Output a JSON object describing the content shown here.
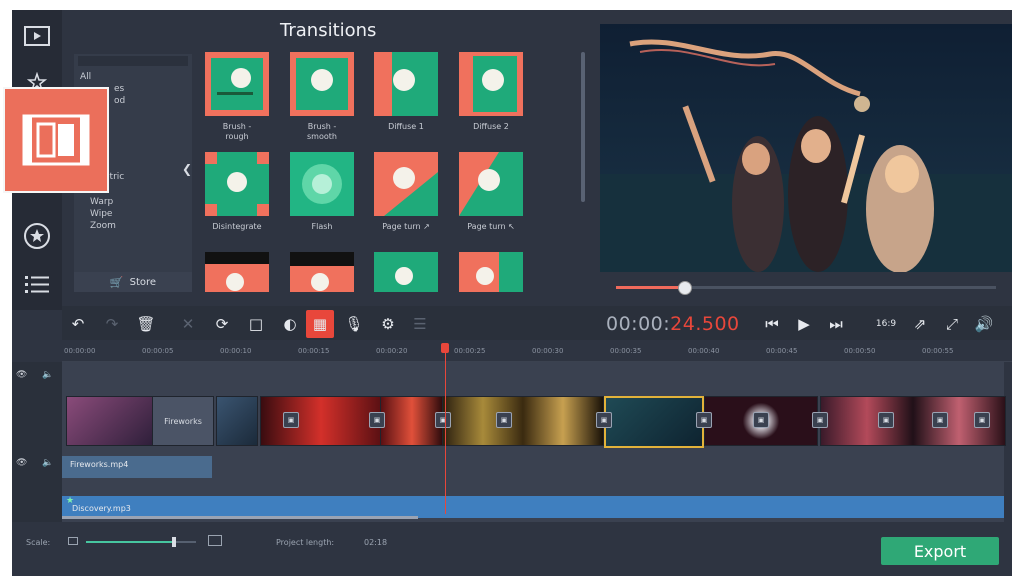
{
  "panel": {
    "title": "Transitions",
    "categories": [
      "All",
      "es",
      "od",
      "etric",
      "Warp",
      "Wipe",
      "Zoom"
    ],
    "store_label": "Store",
    "transitions": [
      {
        "label": "Brush -\nrough"
      },
      {
        "label": "Brush -\nsmooth"
      },
      {
        "label": "Diffuse 1"
      },
      {
        "label": "Diffuse 2"
      },
      {
        "label": "Disintegrate"
      },
      {
        "label": "Flash"
      },
      {
        "label": "Page turn ↗"
      },
      {
        "label": "Page turn ↖"
      }
    ]
  },
  "player": {
    "timecode_main": "00:00:",
    "timecode_accent": "24.500",
    "aspect_label": "16:9",
    "progress": 0.18
  },
  "timeline": {
    "ruler_ticks": [
      "00:00:00",
      "00:00:05",
      "00:00:10",
      "00:00:15",
      "00:00:20",
      "00:00:25",
      "00:00:30",
      "00:00:35",
      "00:00:40",
      "00:00:45",
      "00:00:50",
      "00:00:55"
    ],
    "title_clip": "Fireworks",
    "audio_clip": "Fireworks.mp4",
    "music_clip": "Discovery.mp3"
  },
  "bottom": {
    "scale_label": "Scale:",
    "scale_value": 0.8,
    "project_length_label": "Project length:",
    "project_length": "02:18",
    "export_label": "Export"
  },
  "colors": {
    "accent_red": "#e8473b",
    "export_green": "#2fa876",
    "music_blue": "#3f7fbf",
    "overlay_orange": "#eb6f5b"
  },
  "icons": [
    "film-icon",
    "puzzle-icon",
    "star-icon",
    "list-icon",
    "undo-icon",
    "redo-icon",
    "trash-icon",
    "scissors-icon",
    "rotate-icon",
    "crop-icon",
    "contrast-icon",
    "image-icon",
    "mic-icon",
    "gear-icon",
    "equalizer-icon",
    "skip-back-icon",
    "play-icon",
    "skip-forward-icon",
    "export-small-icon",
    "fullscreen-icon",
    "volume-icon",
    "eye-icon",
    "speaker-icon",
    "store-icon"
  ]
}
